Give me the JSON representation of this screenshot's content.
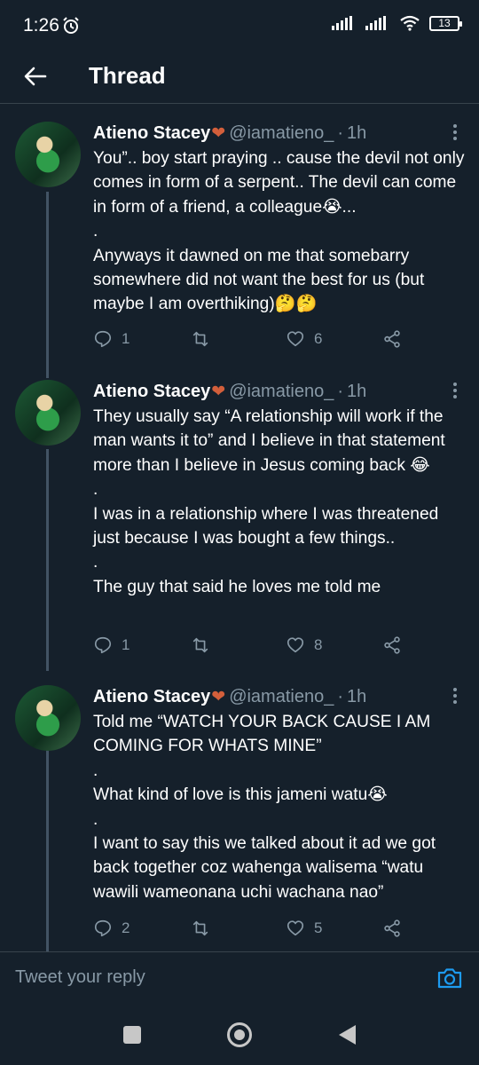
{
  "status_bar": {
    "time": "1:26",
    "battery": "13"
  },
  "header": {
    "title": "Thread"
  },
  "tweets": [
    {
      "name": "Atieno Stacey",
      "handle": "@iamatieno_",
      "sep": "·",
      "time": "1h",
      "lines": [
        "You”.. boy start praying .. cause the devil not only comes in form of a serpent.. The devil can come in form of a friend, a colleague😭...",
        ".",
        "Anyways it dawned on me that somebarry somewhere did not want the best for us (but maybe I am overthiking)🤔🤔"
      ],
      "replies": "1",
      "retweets": "",
      "likes": "6"
    },
    {
      "name": "Atieno Stacey",
      "handle": "@iamatieno_",
      "sep": "·",
      "time": "1h",
      "lines": [
        "They usually say “A relationship will work if the man wants it to” and I believe in that statement more than I believe in Jesus coming back 😂",
        ".",
        "I was in a relationship where I was threatened just because I was bought a few things..",
        ".",
        "The guy that said he loves me told me"
      ],
      "replies": "1",
      "retweets": "",
      "likes": "8"
    },
    {
      "name": "Atieno Stacey",
      "handle": "@iamatieno_",
      "sep": "·",
      "time": "1h",
      "lines": [
        "Told me “WATCH YOUR BACK CAUSE I AM COMING FOR WHATS MINE”",
        ".",
        "What kind of love is this jameni watu😭",
        ".",
        "I want to say this we talked about it ad we got back together coz wahenga walisema “watu wawili wameonana uchi wachana nao”"
      ],
      "replies": "2",
      "retweets": "",
      "likes": "5"
    }
  ],
  "reply_box": {
    "placeholder": "Tweet your reply"
  },
  "icons": {
    "back": "arrow-left-icon",
    "more": "more-vertical-icon",
    "reply": "comment-icon",
    "retweet": "retweet-icon",
    "like": "heart-icon",
    "share": "share-icon",
    "camera": "camera-icon"
  },
  "colors": {
    "background": "#15202b",
    "muted": "#8899a6",
    "accent": "#1d9bf0",
    "heart_emoji": "#d35f3b"
  }
}
